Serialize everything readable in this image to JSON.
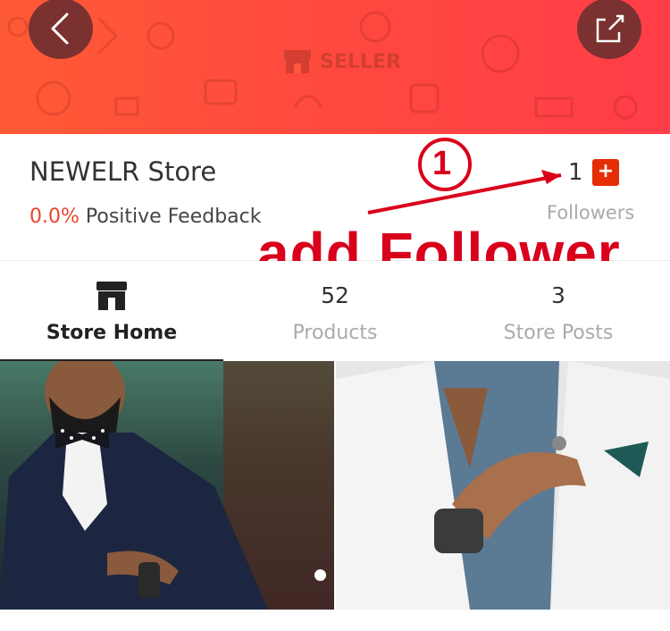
{
  "header": {
    "badge_label": "SELLER",
    "colors": {
      "gradient_start": "#ff5a36",
      "gradient_end": "#ff3d48",
      "button_bg": "#7a3130"
    },
    "icons": {
      "back": "chevron-left-icon",
      "share": "share-icon",
      "badge": "store-icon"
    }
  },
  "store": {
    "name": "NEWELR Store",
    "feedback_percent": "0.0%",
    "feedback_label": "Positive Feedback",
    "followers_count": "1",
    "followers_label": "Followers",
    "follow_button_label": "+"
  },
  "annotation": {
    "step_number": "1",
    "text": "add Follower",
    "color": "#d9001b"
  },
  "tabs": [
    {
      "count": "",
      "label": "Store Home",
      "icon": "store-icon",
      "active": true
    },
    {
      "count": "52",
      "label": "Products",
      "active": false
    },
    {
      "count": "3",
      "label": "Store Posts",
      "active": false
    }
  ],
  "gallery": {
    "images": [
      "man-in-black-tuxedo-photo",
      "man-in-white-blazer-with-bracelets-photo"
    ],
    "carousel_dots": 1
  }
}
